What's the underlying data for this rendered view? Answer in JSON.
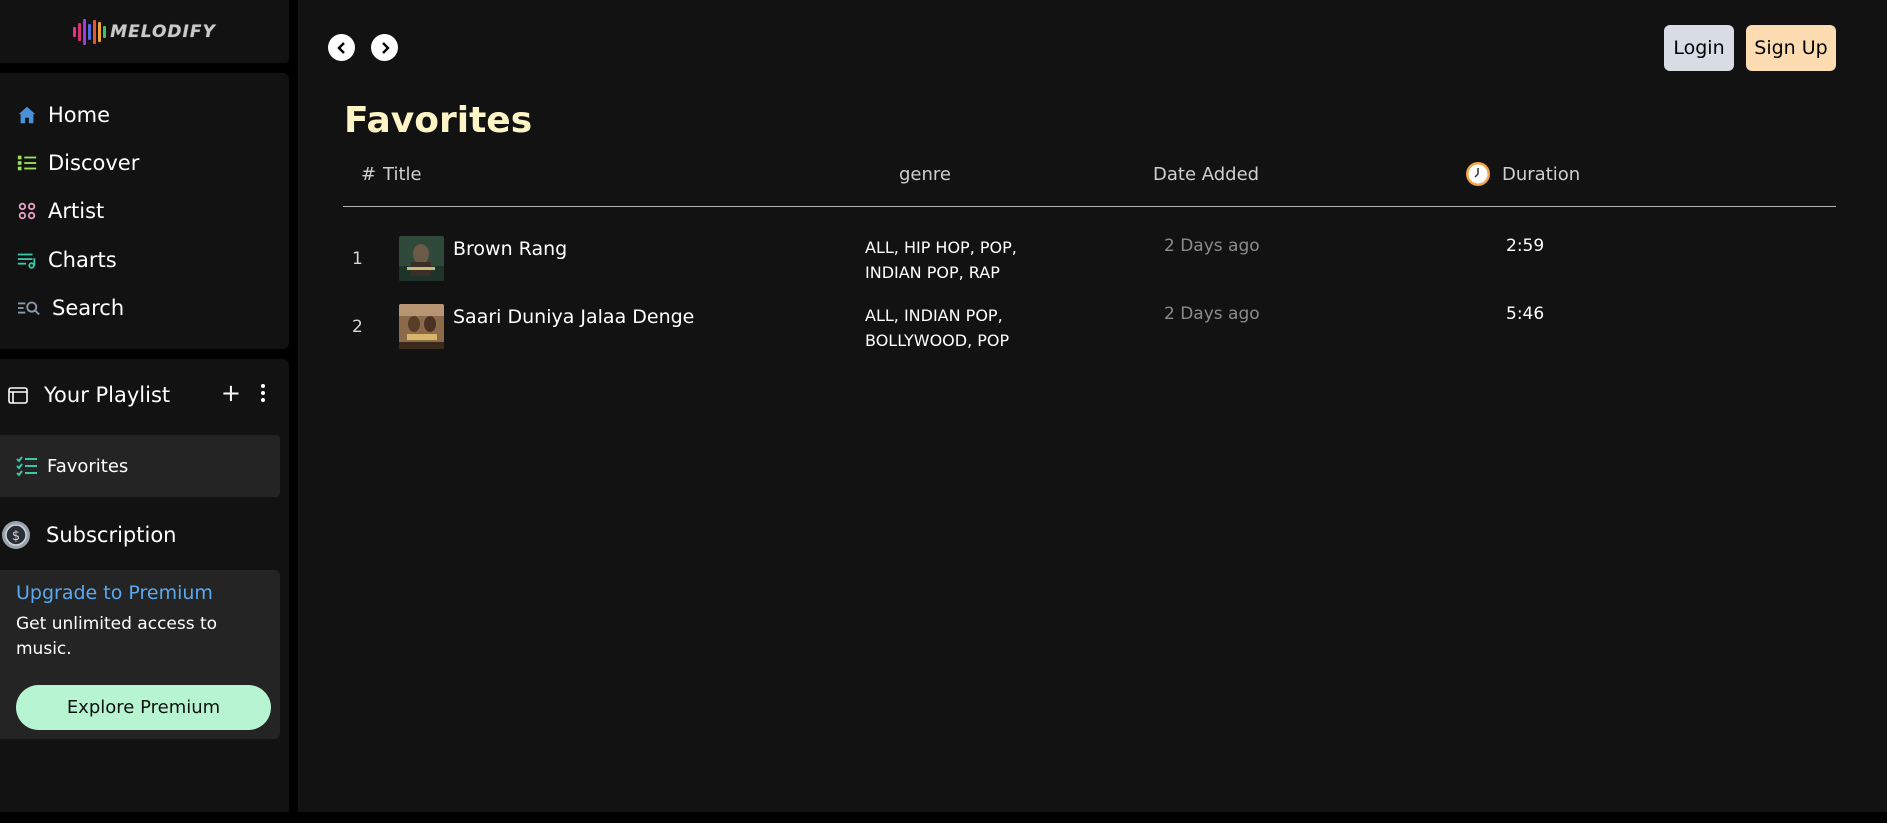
{
  "app": {
    "logo_text": "MELODIFY"
  },
  "nav": {
    "items": [
      {
        "label": "Home",
        "icon": "home-icon"
      },
      {
        "label": "Discover",
        "icon": "list-icon"
      },
      {
        "label": "Artist",
        "icon": "grid-icon"
      },
      {
        "label": "Charts",
        "icon": "chart-list-icon"
      },
      {
        "label": "Search",
        "icon": "search-list-icon"
      }
    ]
  },
  "library": {
    "title": "Your Playlist",
    "favorites_label": "Favorites",
    "subscription_label": "Subscription"
  },
  "premium": {
    "title": "Upgrade to Premium",
    "description": "Get unlimited access to music.",
    "button": "Explore Premium"
  },
  "header": {
    "login": "Login",
    "signup": "Sign Up"
  },
  "page": {
    "title": "Favorites"
  },
  "table": {
    "columns": {
      "num": "#",
      "title": "Title",
      "genre": "genre",
      "date": "Date Added",
      "duration": "Duration"
    },
    "rows": [
      {
        "num": "1",
        "title": "Brown Rang",
        "genre_line1": "ALL, HIP HOP, POP,",
        "genre_line2": "INDIAN POP, RAP",
        "date": "2 Days ago",
        "duration": "2:59"
      },
      {
        "num": "2",
        "title": "Saari Duniya Jalaa Denge",
        "genre_line1": "ALL, INDIAN POP,",
        "genre_line2": "BOLLYWOOD, POP",
        "date": "2 Days ago",
        "duration": "5:46"
      }
    ]
  },
  "colors": {
    "background": "#121212",
    "page_bg": "#000000",
    "accent_teal": "#39c7a5",
    "premium_link": "#5aa9f0",
    "premium_button": "#b7f5d2",
    "title_cream": "#fdf5c6",
    "login_bg": "#d8dde4",
    "signup_bg": "#fddcb2"
  }
}
